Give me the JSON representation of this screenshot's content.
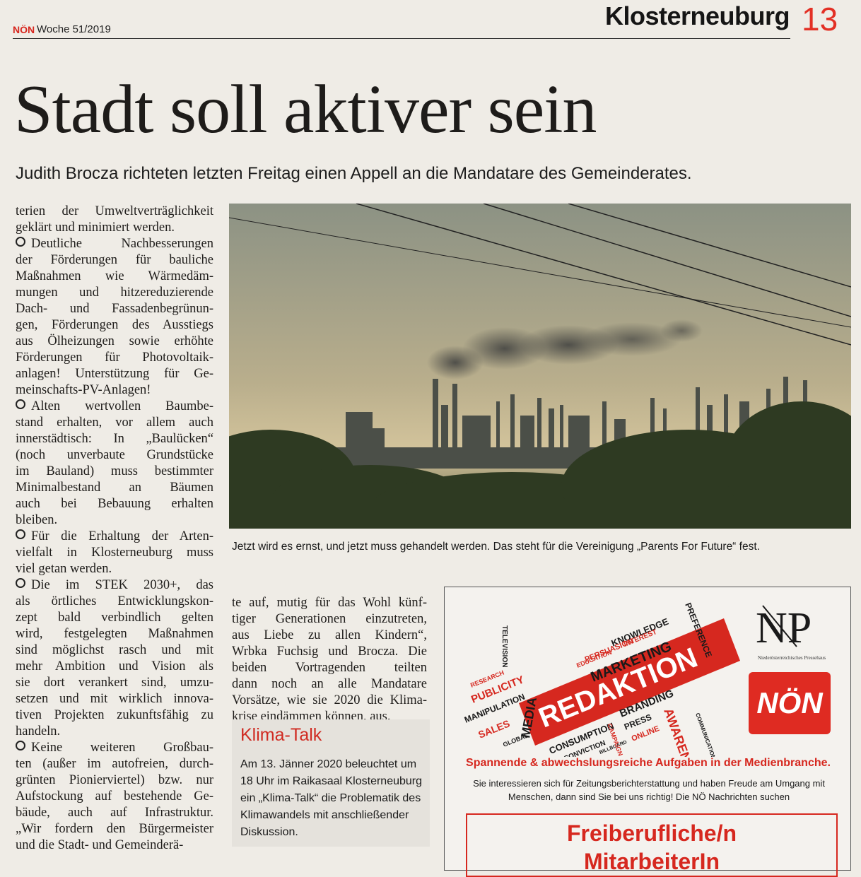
{
  "header": {
    "brand": "NÖN",
    "issue": "Woche 51/2019",
    "section": "Klosterneuburg",
    "page_number": "13"
  },
  "article": {
    "headline": "Stadt soll aktiver sein",
    "subline": "Judith Brocza richteten letzten Freitag einen Appell an die Mandatare des Gemeinderates.",
    "col1_lines": [
      "terien der Umweltverträglichkeit",
      "geklärt und minimiert werden.",
      "• Deutliche Nachbesserungen",
      "der Förderungen für bauliche",
      "Maßnahmen wie Wärmedäm-",
      "mungen und hitzereduzierende",
      "Dach- und Fassadenbegrünun-",
      "gen, Förderungen des Ausstiegs",
      "aus Ölheizungen sowie erhöhte",
      "Förderungen für Photovoltaik-",
      "anlagen! Unterstützung für Ge-",
      "meinschafts-PV-Anlagen!",
      "• Alten wertvollen Baumbe-",
      "stand erhalten, vor allem auch",
      "innerstädtisch: In „Baulücken“",
      "(noch unverbaute Grundstücke",
      "im Bauland) muss bestimmter",
      "Minimalbestand an Bäumen",
      "auch bei Bebauung erhalten",
      "bleiben.",
      "• Für die Erhaltung der Arten-",
      "vielfalt in Klosterneuburg muss",
      "viel getan werden.",
      "• Die im STEK 2030+, das",
      "als örtliches Entwicklungskon-",
      "zept bald verbindlich gelten",
      "wird, festgelegten Maßnahmen",
      "sind möglichst rasch und mit",
      "mehr Ambition und Vision als",
      "sie dort verankert sind, umzu-",
      "setzen und mit wirklich innova-",
      "tiven Projekten zukunftsfähig zu",
      "handeln.",
      "• Keine weiteren Großbau-",
      "ten (außer im autofreien, durch-",
      "grünten Pionierviertel) bzw. nur",
      "Aufstockung auf bestehende Ge-",
      "bäude, auch auf Infrastruktur.",
      "„Wir fordern den Bürgermeister",
      "und die Stadt- und Gemeinderä-"
    ],
    "col2_lines": [
      "te auf, mutig für das Wohl künf-",
      "tiger Generationen einzutreten,",
      "aus Liebe zu allen Kindern“,",
      "Wrbka Fuchsig und Brocza. Die",
      "beiden Vortragenden teilten",
      "dann noch an alle Mandatare",
      "Vorsätze, wie sie 2020 die Klima-",
      "krise eindämmen können, aus."
    ],
    "photo_caption": "Jetzt wird es ernst, und jetzt muss gehandelt werden. Das steht für die Vereinigung „Parents For Future“ fest.",
    "infobox": {
      "title": "Klima-Talk",
      "text": "Am 13. Jänner 2020 beleuchtet um 18 Uhr im Raikasaal Klosterneuburg ein „Klima-Talk“ die Problematik des Klimawandels mit anschließender Diskussion."
    }
  },
  "ad": {
    "banner_word": "REDAKTION",
    "cloud_words": [
      "MARKETING",
      "KNOWLEDGE",
      "PERSUASION",
      "INTEREST",
      "EDUCATION",
      "PREFERENCE",
      "TELEVISION",
      "PUBLICITY",
      "MANIPULATION",
      "SALES",
      "GLOBAL",
      "MEDIA",
      "CONSUMPTION",
      "BRANDING",
      "PRESS",
      "ONLINE",
      "AWARENESS",
      "CONVICTION",
      "BILLBOARD",
      "CAMPAIGN",
      "RESEARCH",
      "COMMUNICATION"
    ],
    "np_logo": "NP",
    "np_subtitle": "Niederösterreichisches Pressehaus",
    "non_logo": "NÖN",
    "tagline": "Spannende & abwechslungsreiche Aufgaben in der Medienbranche.",
    "text": "Sie interessieren sich für Zeitungsberichterstattung und haben Freude am Umgang mit Menschen, dann sind Sie bei uns richtig! Die NÖ Nachrichten suchen",
    "job_line1": "Freiberufliche/n",
    "job_line2": "MitarbeiterIn"
  },
  "colors": {
    "accent_red": "#d6281f",
    "paper": "#efece6"
  }
}
